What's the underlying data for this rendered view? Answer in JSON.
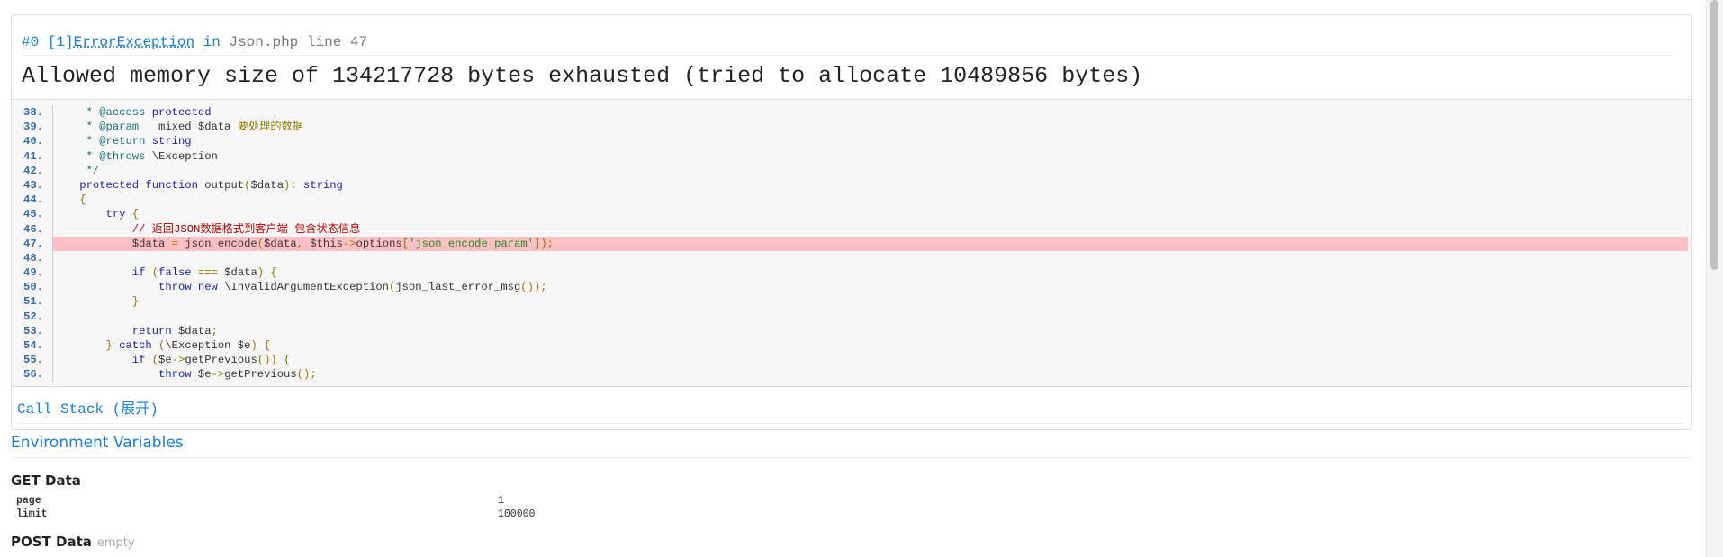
{
  "exception": {
    "index": "#0",
    "code": "[1]",
    "class": "ErrorException",
    "in_word": "in",
    "file": "Json.php",
    "line_word": "line",
    "line": "47",
    "message": "Allowed memory size of 134217728 bytes exhausted (tried to allocate 10489856 bytes)"
  },
  "source": {
    "highlight_line": "47.",
    "lines": [
      {
        "n": "38.",
        "parts": [
          [
            "cm",
            "     * @access "
          ],
          [
            "kw",
            "protected"
          ]
        ]
      },
      {
        "n": "39.",
        "parts": [
          [
            "cm",
            "     * @param "
          ],
          [
            "",
            "  mixed $data "
          ],
          [
            "zh",
            "要处理的数据"
          ]
        ]
      },
      {
        "n": "40.",
        "parts": [
          [
            "cm",
            "     * @return "
          ],
          [
            "kw",
            "string"
          ]
        ]
      },
      {
        "n": "41.",
        "parts": [
          [
            "cm",
            "     * @throws "
          ],
          [
            "",
            "\\Exception"
          ]
        ]
      },
      {
        "n": "42.",
        "parts": [
          [
            "cm",
            "     */"
          ]
        ]
      },
      {
        "n": "43.",
        "parts": [
          [
            "kw",
            "    protected function "
          ],
          [
            "",
            "output"
          ],
          [
            "pn",
            "("
          ],
          [
            "",
            "$data"
          ],
          [
            "pn",
            "): "
          ],
          [
            "kw",
            "string"
          ]
        ]
      },
      {
        "n": "44.",
        "parts": [
          [
            "pn",
            "    {"
          ]
        ]
      },
      {
        "n": "45.",
        "parts": [
          [
            "kw",
            "        try "
          ],
          [
            "pn",
            "{"
          ]
        ]
      },
      {
        "n": "46.",
        "parts": [
          [
            "redzh",
            "            // 返回JSON数据格式到客户端 包含状态信息"
          ]
        ]
      },
      {
        "n": "47.",
        "parts": [
          [
            "",
            "            $data "
          ],
          [
            "pn",
            "= "
          ],
          [
            "",
            "json_encode"
          ],
          [
            "pn",
            "("
          ],
          [
            "",
            "$data"
          ],
          [
            "pn",
            ", "
          ],
          [
            "",
            "$this"
          ],
          [
            "pn",
            "->"
          ],
          [
            "",
            "options"
          ],
          [
            "pn",
            "["
          ],
          [
            "str",
            "'json_encode_param'"
          ],
          [
            "pn",
            "]);"
          ]
        ]
      },
      {
        "n": "48.",
        "parts": [
          [
            "",
            ""
          ]
        ]
      },
      {
        "n": "49.",
        "parts": [
          [
            "kw",
            "            if "
          ],
          [
            "pn",
            "("
          ],
          [
            "kw",
            "false "
          ],
          [
            "pn",
            "=== "
          ],
          [
            "",
            "$data"
          ],
          [
            "pn",
            ") {"
          ]
        ]
      },
      {
        "n": "50.",
        "parts": [
          [
            "kw",
            "                throw new "
          ],
          [
            "",
            "\\InvalidArgumentException"
          ],
          [
            "pn",
            "("
          ],
          [
            "",
            "json_last_error_msg"
          ],
          [
            "pn",
            "());"
          ]
        ]
      },
      {
        "n": "51.",
        "parts": [
          [
            "pn",
            "            }"
          ]
        ]
      },
      {
        "n": "52.",
        "parts": [
          [
            "",
            ""
          ]
        ]
      },
      {
        "n": "53.",
        "parts": [
          [
            "kw",
            "            return "
          ],
          [
            "",
            "$data"
          ],
          [
            "pn",
            ";"
          ]
        ]
      },
      {
        "n": "54.",
        "parts": [
          [
            "pn",
            "        } "
          ],
          [
            "kw",
            "catch "
          ],
          [
            "pn",
            "("
          ],
          [
            "",
            "\\Exception $e"
          ],
          [
            "pn",
            ") {"
          ]
        ]
      },
      {
        "n": "55.",
        "parts": [
          [
            "kw",
            "            if "
          ],
          [
            "pn",
            "("
          ],
          [
            "",
            "$e"
          ],
          [
            "pn",
            "->"
          ],
          [
            "",
            "getPrevious"
          ],
          [
            "pn",
            "()) {"
          ]
        ]
      },
      {
        "n": "56.",
        "parts": [
          [
            "kw",
            "                throw "
          ],
          [
            "",
            "$e"
          ],
          [
            "pn",
            "->"
          ],
          [
            "",
            "getPrevious"
          ],
          [
            "pn",
            "();"
          ]
        ]
      }
    ]
  },
  "call_stack": {
    "label": "Call Stack (展开)"
  },
  "env": {
    "title": "Environment Variables",
    "get_title": "GET Data",
    "get": [
      {
        "key": "page",
        "value": "1"
      },
      {
        "key": "limit",
        "value": "100000"
      }
    ],
    "post_title": "POST Data",
    "post_empty": "empty"
  }
}
